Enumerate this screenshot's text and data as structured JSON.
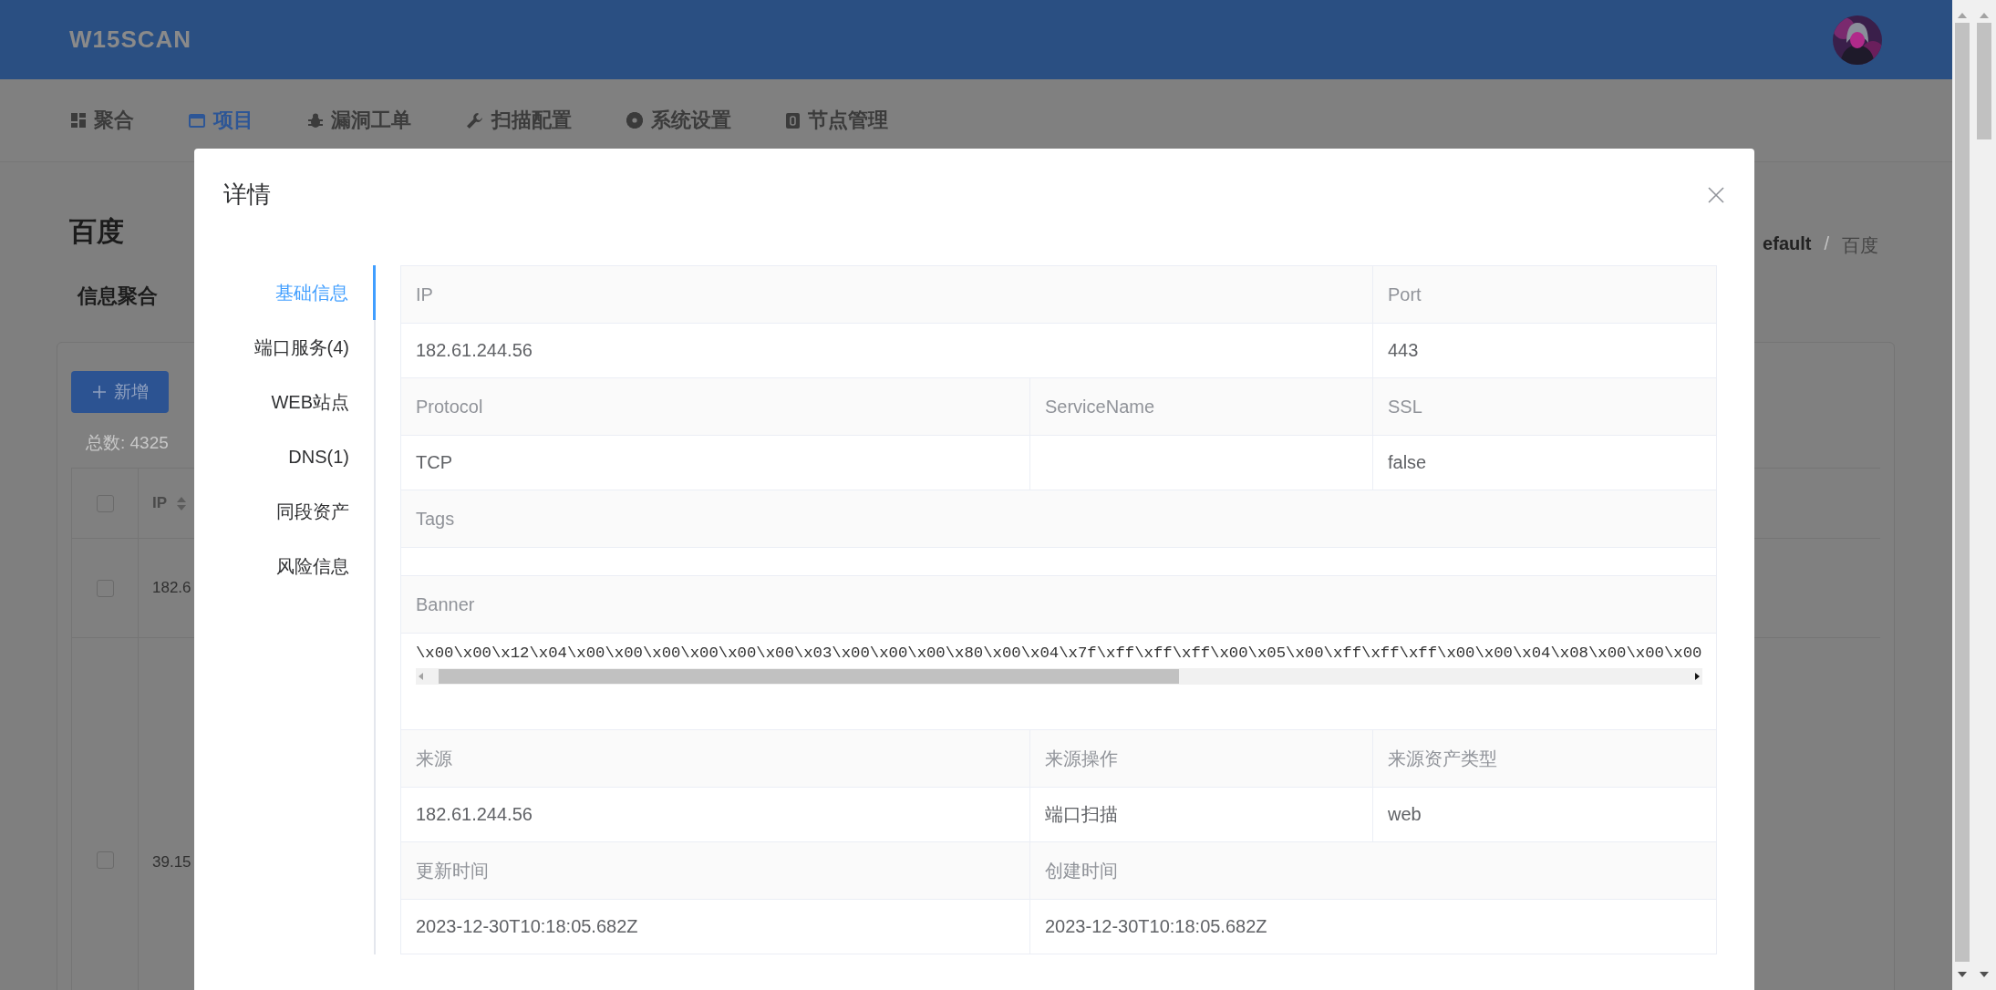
{
  "header": {
    "logo": "W15SCAN"
  },
  "nav": [
    {
      "label": "聚合",
      "selected": false
    },
    {
      "label": "项目",
      "selected": true
    },
    {
      "label": "漏洞工单",
      "selected": false
    },
    {
      "label": "扫描配置",
      "selected": false
    },
    {
      "label": "系统设置",
      "selected": false
    },
    {
      "label": "节点管理",
      "selected": false
    }
  ],
  "page": {
    "title": "百度",
    "breadcrumb": {
      "items": [
        "efault",
        "百度"
      ],
      "separator": "/"
    },
    "section": "信息聚合",
    "add_button": "新增",
    "total": "总数: 4325",
    "table": {
      "columns": [
        "IP"
      ],
      "header_checked": false,
      "rows": [
        {
          "checked": false,
          "cells": [
            "182.6"
          ]
        },
        {
          "checked": false,
          "cells": [
            "39.15"
          ]
        }
      ]
    }
  },
  "modal": {
    "title": "详情",
    "tabs": [
      {
        "label": "基础信息",
        "selected": true
      },
      {
        "label": "端口服务(4)",
        "selected": false
      },
      {
        "label": "WEB站点",
        "selected": false
      },
      {
        "label": "DNS(1)",
        "selected": false
      },
      {
        "label": "同段资产",
        "selected": false
      },
      {
        "label": "风险信息",
        "selected": false
      }
    ],
    "details": [
      {
        "kind": "wide-first",
        "fields": [
          {
            "label": "IP",
            "value": "182.61.244.56"
          },
          {
            "label": "Port",
            "value": "443"
          }
        ]
      },
      {
        "kind": "thirds",
        "fields": [
          {
            "label": "Protocol",
            "value": "TCP"
          },
          {
            "label": "ServiceName"
          },
          {
            "label": "SSL",
            "value": "false"
          }
        ]
      },
      {
        "kind": "full",
        "fields": [
          {
            "label": "Tags"
          }
        ]
      },
      {
        "kind": "full",
        "fields": [
          {
            "label": "Banner",
            "kind": "code",
            "value": "\\x00\\x00\\x12\\x04\\x00\\x00\\x00\\x00\\x00\\x00\\x03\\x00\\x00\\x00\\x80\\x00\\x04\\x7f\\xff\\xff\\xff\\x00\\x05\\x00\\xff\\xff\\xff\\x00\\x00\\x04\\x08\\x00\\x00\\x00"
          }
        ]
      },
      {
        "kind": "thirds",
        "fields": [
          {
            "label": "来源",
            "value": "182.61.244.56"
          },
          {
            "label": "来源操作",
            "value": "端口扫描"
          },
          {
            "label": "来源资产类型",
            "value": "web"
          }
        ]
      },
      {
        "kind": "wide-last",
        "fields": [
          {
            "label": "更新时间",
            "value": "2023-12-30T10:18:05.682Z"
          },
          {
            "label": "创建时间",
            "value": "2023-12-30T10:18:05.682Z"
          }
        ]
      }
    ]
  }
}
